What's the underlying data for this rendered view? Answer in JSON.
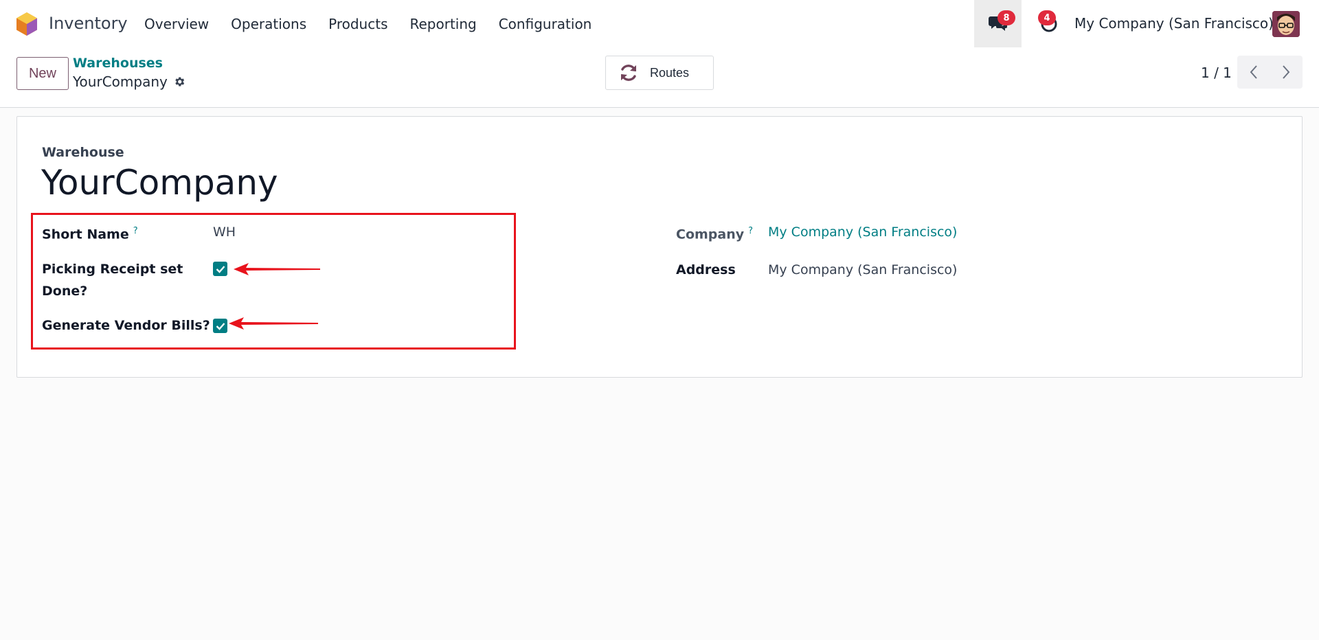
{
  "navbar": {
    "app_name": "Inventory",
    "menu": [
      "Overview",
      "Operations",
      "Products",
      "Reporting",
      "Configuration"
    ],
    "messages_count": "8",
    "activities_count": "4",
    "company": "My Company (San Francisco)"
  },
  "control_panel": {
    "new_label": "New",
    "breadcrumb_parent": "Warehouses",
    "breadcrumb_current": "YourCompany",
    "routes_label": "Routes",
    "pager": "1 / 1"
  },
  "form": {
    "header_label": "Warehouse",
    "title": "YourCompany",
    "short_name_label": "Short Name",
    "short_name_value": "WH",
    "picking_receipt_label_line1": "Picking Receipt set",
    "picking_receipt_label_line2": "Done?",
    "picking_receipt_checked": true,
    "vendor_bills_label": "Generate Vendor Bills?",
    "vendor_bills_checked": true,
    "company_label": "Company",
    "company_value": "My Company (San Francisco)",
    "address_label": "Address",
    "address_value": "My Company (San Francisco)",
    "help_mark": "?"
  },
  "colors": {
    "accent": "#017e84",
    "brand": "#71435a",
    "badge": "#e02a3c",
    "annotation": "#e8131c"
  }
}
